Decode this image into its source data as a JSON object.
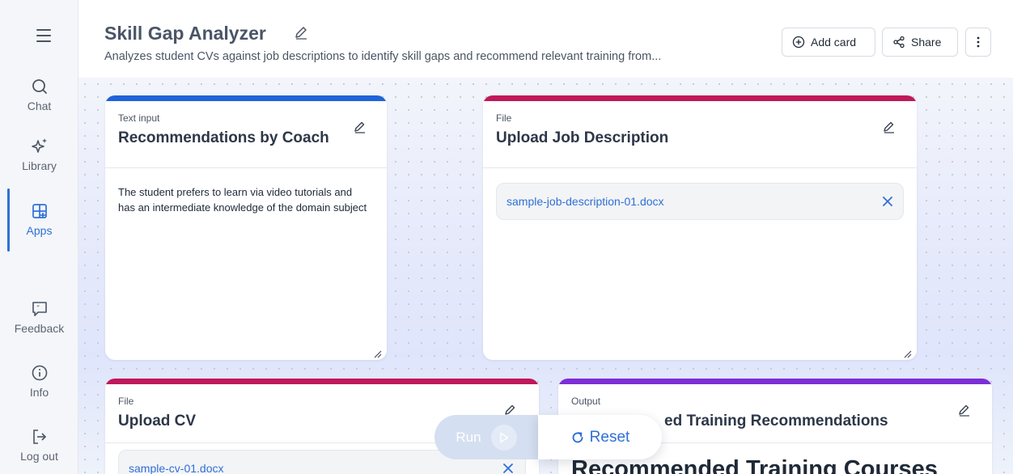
{
  "sidebar": {
    "items": [
      {
        "label": "Chat",
        "icon": "search-icon"
      },
      {
        "label": "Library",
        "icon": "sparkles-icon"
      },
      {
        "label": "Apps",
        "icon": "apps-grid-icon"
      },
      {
        "label": "Feedback",
        "icon": "feedback-icon"
      },
      {
        "label": "Info",
        "icon": "info-icon"
      },
      {
        "label": "Log out",
        "icon": "logout-icon"
      }
    ],
    "active": "Apps"
  },
  "header": {
    "title": "Skill Gap Analyzer",
    "subtitle": "Analyzes student CVs against job descriptions to identify skill gaps and recommend relevant training from...",
    "add_card_label": "Add card",
    "share_label": "Share"
  },
  "cards": {
    "coach": {
      "kind": "Text input",
      "title": "Recommendations by Coach",
      "body": "The student prefers to learn via video tutorials and has an intermediate knowledge of the domain subject"
    },
    "job": {
      "kind": "File",
      "title": "Upload Job Description",
      "file": "sample-job-description-01.docx"
    },
    "cv": {
      "kind": "File",
      "title": "Upload CV",
      "file": "sample-cv-01.docx"
    },
    "output": {
      "kind": "Output",
      "title_visible": "ed Training Recommendations",
      "heading": "Recommended Training Courses"
    }
  },
  "actions": {
    "run_label": "Run",
    "reset_label": "Reset"
  },
  "colors": {
    "accent": "#2f6fd6",
    "text_input_bar": "#1f63d9",
    "file_bar": "#c0185a",
    "output_bar": "#7d2ed6"
  }
}
